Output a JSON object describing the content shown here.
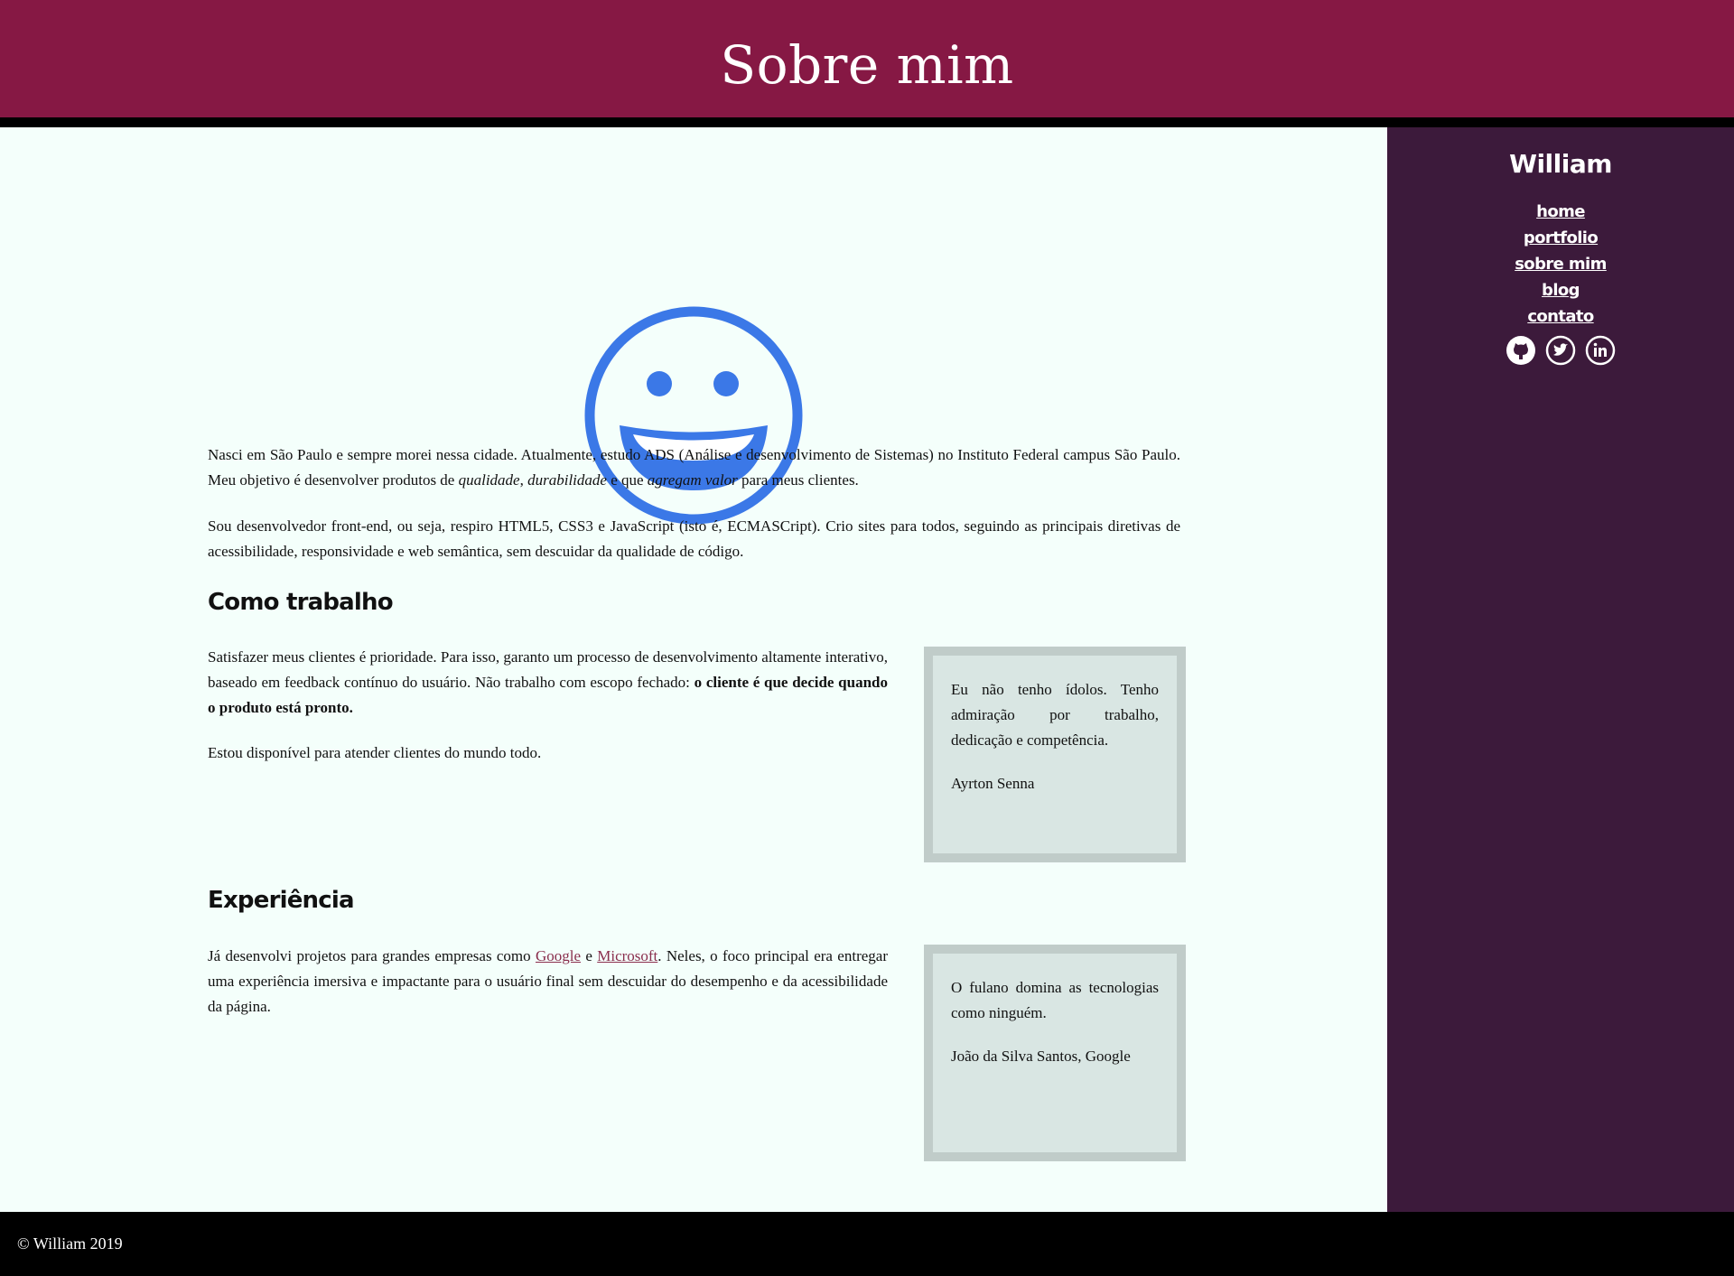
{
  "header": {
    "title": "Sobre mim"
  },
  "sidebar": {
    "name": "William",
    "nav": [
      "home",
      "portfolio",
      "sobre mim",
      "blog",
      "contato"
    ],
    "social_icons": [
      "github-icon",
      "twitter-icon",
      "linkedin-icon"
    ]
  },
  "hero": {
    "icon": "smiley-face-icon",
    "color": "#3b78e7"
  },
  "intro": {
    "p1_a": "Nasci em São Paulo e sempre morei nessa cidade. Atualmente, estudo ADS (Análise e desenvolvimento de Sistemas) no Instituto Federal campus São Paulo. Meu objetivo é desenvolver produtos de ",
    "p1_em1": "qualidade",
    "p1_b": ", ",
    "p1_em2": "durabilidade",
    "p1_c": " e que ",
    "p1_em3": "agregam valor",
    "p1_d": " para meus clientes.",
    "p2": "Sou desenvolvedor front-end, ou seja, respiro HTML5, CSS3 e JavaScript (isto é, ECMASCript). Crio sites para todos, seguindo as principais diretivas de acessibilidade, responsividade e web semântica, sem descuidar da qualidade de código."
  },
  "como_trabalho": {
    "title": "Como trabalho",
    "p1_a": "Satisfazer meus clientes é prioridade. Para isso, garanto um processo de desenvolvimento altamente interativo, baseado em feedback contínuo do usuário. Não trabalho com escopo fechado: ",
    "p1_strong": "o cliente é que decide quando o produto está pronto.",
    "p2": "Estou disponível para atender clientes do mundo todo.",
    "quote_text": "Eu não tenho ídolos. Tenho admiração por trabalho, dedicação e competência.",
    "quote_author": "Ayrton Senna"
  },
  "experiencia": {
    "title": "Experiência",
    "p_a": "Já desenvolvi projetos para grandes empresas como ",
    "link1": "Google",
    "p_b": " e ",
    "link2": "Microsoft",
    "p_c": ". Neles, o foco principal era entregar uma experiência imersiva e impactante para o usuário final sem descuidar do desempenho e da acessibilidade da página.",
    "quote_text": "O fulano domina as tecnologias como ninguém.",
    "quote_author": "João da Silva Santos, Google"
  },
  "footer": {
    "text": "© William 2019"
  },
  "colors": {
    "header_bg": "#861844",
    "sidebar_bg": "#3c1a3b",
    "main_bg": "#f4fffb",
    "quote_bg": "#d9e6e3",
    "quote_border": "#c0ccc9",
    "link": "#8a2e4d"
  }
}
